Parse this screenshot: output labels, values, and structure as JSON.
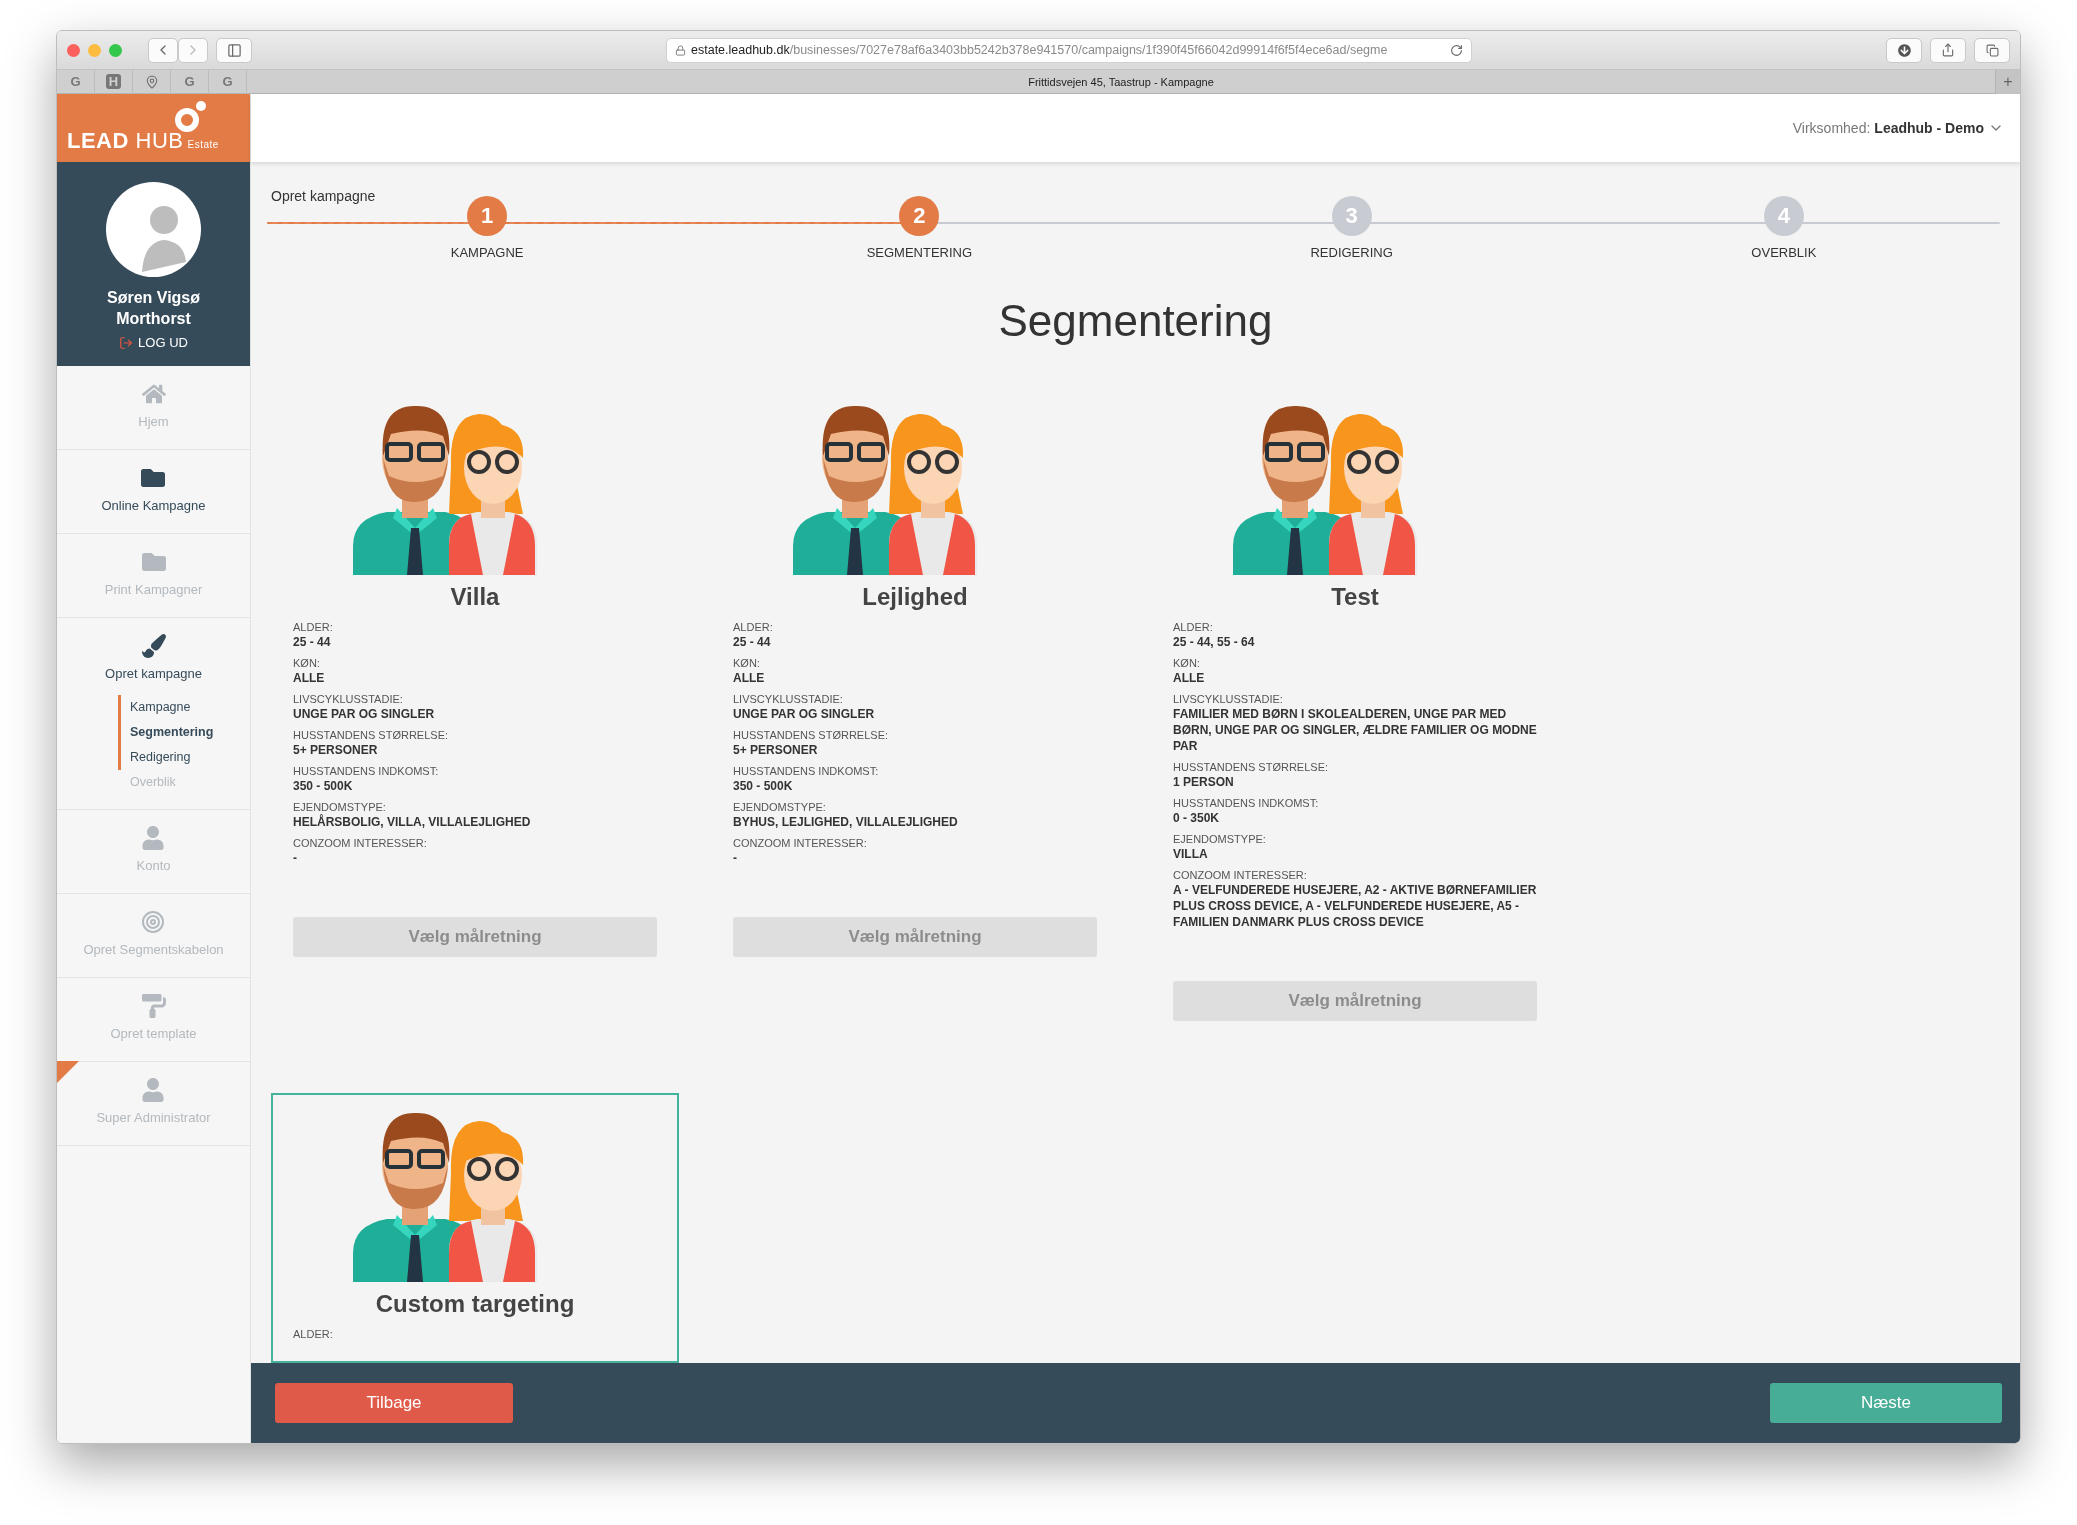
{
  "browser": {
    "url_host": "estate.leadhub.dk",
    "url_path": "/businesses/7027e78af6a3403bb5242b378e941570/campaigns/1f390f45f66042d99914f6f5f4ece6ad/segme",
    "tab_title": "Frittidsvejen 45, Taastrup - Kampagne",
    "new_tab": "+",
    "bookmarks": [
      {
        "kind": "letter",
        "label": "G"
      },
      {
        "kind": "badge",
        "label": "H"
      },
      {
        "kind": "pin"
      },
      {
        "kind": "letter",
        "label": "G"
      },
      {
        "kind": "letter",
        "label": "G"
      }
    ]
  },
  "logo": {
    "bold": "LEAD",
    "light": "HUB",
    "suffix": "Estate"
  },
  "header": {
    "company_label": "Virksomhed:",
    "company": "Leadhub - Demo"
  },
  "profile": {
    "name": "Søren Vigsø Morthorst",
    "logout": "LOG UD"
  },
  "sidebar": {
    "items": [
      {
        "label": "Hjem",
        "active": false,
        "flagged": false
      },
      {
        "label": "Online Kampagne",
        "active": true,
        "flagged": false
      },
      {
        "label": "Print Kampagner",
        "active": false,
        "flagged": false
      },
      {
        "label": "Opret kampagne",
        "active": true,
        "flagged": false,
        "children": [
          {
            "label": "Kampagne",
            "reached": true,
            "selected": false
          },
          {
            "label": "Segmentering",
            "reached": true,
            "selected": true
          },
          {
            "label": "Redigering",
            "reached": true,
            "selected": false
          },
          {
            "label": "Overblik",
            "reached": false,
            "selected": false
          }
        ]
      },
      {
        "label": "Konto",
        "active": false,
        "flagged": false
      },
      {
        "label": "Opret Segmentskabelon",
        "active": false,
        "flagged": false
      },
      {
        "label": "Opret template",
        "active": false,
        "flagged": false
      },
      {
        "label": "Super Administrator",
        "active": false,
        "flagged": true
      }
    ]
  },
  "stepper": {
    "label": "Opret kampagne",
    "level": 0.375,
    "steps": [
      {
        "number": "1",
        "label": "KAMPAGNE",
        "reached": true
      },
      {
        "number": "2",
        "label": "SEGMENTERING",
        "reached": true
      },
      {
        "number": "3",
        "label": "REDIGERING",
        "reached": false
      },
      {
        "number": "4",
        "label": "OVERBLIK",
        "reached": false
      }
    ]
  },
  "title": "Segmentering",
  "cards": [
    {
      "title": "Villa",
      "selected": false,
      "fields": [
        {
          "label": "ALDER:",
          "value": "25 - 44"
        },
        {
          "label": "KØN:",
          "value": "ALLE"
        },
        {
          "label": "LIVSCYKLUSSTADIE:",
          "value": "UNGE PAR OG SINGLER"
        },
        {
          "label": "HUSSTANDENS STØRRELSE:",
          "value": "5+ PERSONER"
        },
        {
          "label": "HUSSTANDENS INDKOMST:",
          "value": "350 - 500K"
        },
        {
          "label": "EJENDOMSTYPE:",
          "value": "HELÅRSBOLIG, VILLA, VILLALEJLIGHED"
        },
        {
          "label": "CONZOOM INTERESSER:",
          "value": "-"
        }
      ],
      "button": {
        "label": "Vælg målretning",
        "disabled": true
      }
    },
    {
      "title": "Lejlighed",
      "selected": false,
      "fields": [
        {
          "label": "ALDER:",
          "value": "25 - 44"
        },
        {
          "label": "KØN:",
          "value": "ALLE"
        },
        {
          "label": "LIVSCYKLUSSTADIE:",
          "value": "UNGE PAR OG SINGLER"
        },
        {
          "label": "HUSSTANDENS STØRRELSE:",
          "value": "5+ PERSONER"
        },
        {
          "label": "HUSSTANDENS INDKOMST:",
          "value": "350 - 500K"
        },
        {
          "label": "EJENDOMSTYPE:",
          "value": "BYHUS, LEJLIGHED, VILLALEJLIGHED"
        },
        {
          "label": "CONZOOM INTERESSER:",
          "value": "-"
        }
      ],
      "button": {
        "label": "Vælg målretning",
        "disabled": true
      }
    },
    {
      "title": "Test",
      "selected": false,
      "fields": [
        {
          "label": "ALDER:",
          "value": "25 - 44, 55 - 64"
        },
        {
          "label": "KØN:",
          "value": "ALLE"
        },
        {
          "label": "LIVSCYKLUSSTADIE:",
          "value": "FAMILIER MED BØRN I SKOLEALDEREN, UNGE PAR MED BØRN, UNGE PAR OG SINGLER, ÆLDRE FAMILIER OG MODNE PAR"
        },
        {
          "label": "HUSSTANDENS STØRRELSE:",
          "value": "1 PERSON"
        },
        {
          "label": "HUSSTANDENS INDKOMST:",
          "value": "0 - 350K"
        },
        {
          "label": "EJENDOMSTYPE:",
          "value": "VILLA"
        },
        {
          "label": "CONZOOM INTERESSER:",
          "value": "A - VELFUNDEREDE HUSEJERE, A2 - AKTIVE BØRNEFAMILIER PLUS CROSS DEVICE, A - VELFUNDEREDE HUSEJERE, A5 - FAMILIEN DANMARK PLUS CROSS DEVICE"
        }
      ],
      "button": {
        "label": "Vælg målretning",
        "disabled": true
      }
    },
    {
      "title": "Custom targeting",
      "selected": true,
      "fields": [
        {
          "label": "ALDER:"
        }
      ]
    }
  ],
  "footer": {
    "back": "Tilbage",
    "next": "Næste"
  }
}
